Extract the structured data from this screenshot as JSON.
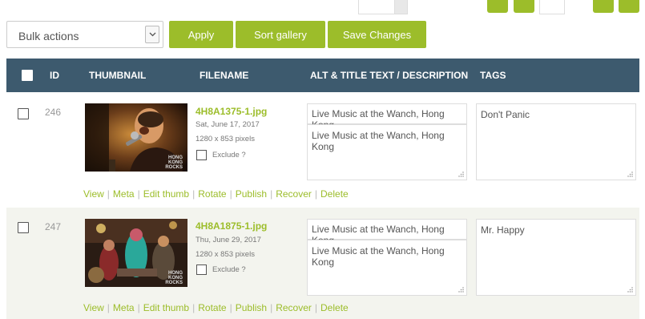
{
  "toolbar": {
    "bulk_actions": "Bulk actions",
    "apply": "Apply",
    "sort_gallery": "Sort gallery",
    "save_changes": "Save Changes"
  },
  "table": {
    "columns": {
      "id": "ID",
      "thumbnail": "THUMBNAIL",
      "filename": "FILENAME",
      "alt_title": "ALT & TITLE TEXT / DESCRIPTION",
      "tags": "TAGS"
    }
  },
  "rows": [
    {
      "id": "246",
      "filename": "4H8A1375-1.jpg",
      "date": "Sat, June 17, 2017",
      "dimensions": "1280 x 853 pixels",
      "exclude_label": "Exclude ?",
      "alt_title": "Live Music at the Wanch, Hong Kong",
      "description": "Live Music at the Wanch, Hong Kong",
      "tags": "Don't Panic",
      "watermark": "HONG KONG ROCKS"
    },
    {
      "id": "247",
      "filename": "4H8A1875-1.jpg",
      "date": "Thu, June 29, 2017",
      "dimensions": "1280 x 853 pixels",
      "exclude_label": "Exclude ?",
      "alt_title": "Live Music at the Wanch, Hong Kong",
      "description": "Live Music at the Wanch, Hong Kong",
      "tags": "Mr. Happy",
      "watermark": "HONG KONG ROCKS"
    }
  ],
  "row_actions": [
    "View",
    "Meta",
    "Edit thumb",
    "Rotate",
    "Publish",
    "Recover",
    "Delete"
  ],
  "colors": {
    "accent": "#9cbd2a",
    "header": "#3d5a6e"
  }
}
